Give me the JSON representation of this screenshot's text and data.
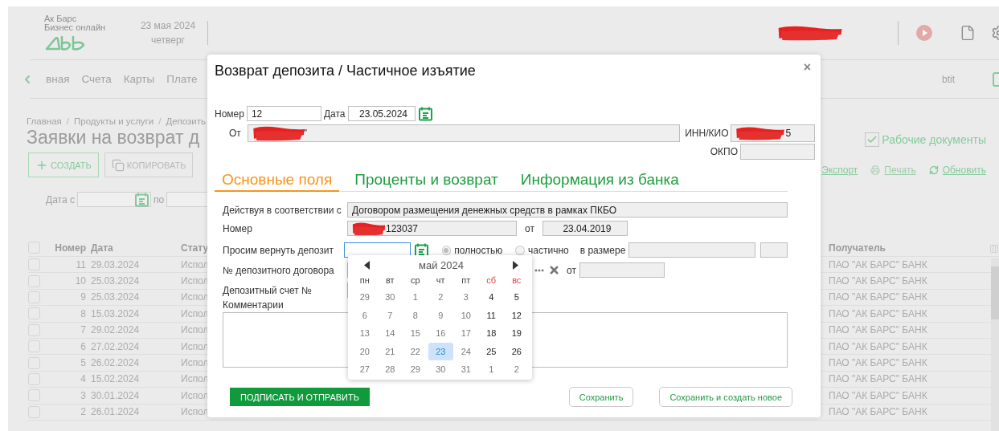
{
  "header": {
    "brand": "Ак Барс",
    "subtitle": "Бизнес онлайн",
    "date": "23 мая 2024",
    "weekday": "четверг"
  },
  "nav": {
    "items": [
      "вная",
      "Счета",
      "Карты",
      "Плате"
    ],
    "user": "btit"
  },
  "breadcrumb": [
    {
      "kind": "link",
      "text": "Главная"
    },
    {
      "kind": "separator",
      "text": "/"
    },
    {
      "kind": "link",
      "text": "Продукты и услуги"
    },
    {
      "kind": "separator",
      "text": "/"
    },
    {
      "kind": "link",
      "text": "Депозить"
    }
  ],
  "page_title": "Заявки на возврат д",
  "toolbar": {
    "buttons": [
      {
        "label": "СОЗДАТЬ",
        "kind": "create",
        "disabled": false
      },
      {
        "label": "КОПИРОВАТЬ",
        "kind": "copy",
        "disabled": true
      }
    ],
    "working_docs": {
      "label": "Рабочие документы",
      "checked": true
    },
    "actions": [
      {
        "label": "Экспорт",
        "kind": "export",
        "disabled": false
      },
      {
        "label": "Печать",
        "kind": "print",
        "disabled": true
      },
      {
        "label": "Обновить",
        "kind": "refresh",
        "disabled": false
      }
    ]
  },
  "filter": {
    "from_label": "Дата с",
    "to_label": "по"
  },
  "table": {
    "select_all_checked": false,
    "columns": [
      "Номер",
      "Дата",
      "Стату",
      "Получатель"
    ],
    "rows": [
      {
        "checked": false,
        "number": "11",
        "date": "29.03.2024",
        "status": "Испол",
        "recipient": "ПАО \"АК БАРС\" БАНК"
      },
      {
        "checked": false,
        "number": "10",
        "date": "25.03.2024",
        "status": "Испол",
        "recipient": "ПАО \"АК БАРС\" БАНК"
      },
      {
        "checked": false,
        "number": "9",
        "date": "25.03.2024",
        "status": "Испол",
        "recipient": "ПАО \"АК БАРС\" БАНК"
      },
      {
        "checked": false,
        "number": "8",
        "date": "15.03.2024",
        "status": "Испол",
        "recipient": "ПАО \"АК БАРС\" БАНК"
      },
      {
        "checked": false,
        "number": "7",
        "date": "29.02.2024",
        "status": "Испол",
        "recipient": "ПАО \"АК БАРС\" БАНК"
      },
      {
        "checked": false,
        "number": "6",
        "date": "27.02.2024",
        "status": "Испол",
        "recipient": "ПАО \"АК БАРС\" БАНК"
      },
      {
        "checked": false,
        "number": "5",
        "date": "26.02.2024",
        "status": "Испол",
        "recipient": "ПАО \"АК БАРС\" БАНК"
      },
      {
        "checked": false,
        "number": "4",
        "date": "15.02.2024",
        "status": "Испол",
        "recipient": "ПАО \"АК БАРС\" БАНК"
      },
      {
        "checked": false,
        "number": "3",
        "date": "30.01.2024",
        "status": "Испол",
        "recipient": "ПАО \"АК БАРС\" БАНК"
      },
      {
        "checked": false,
        "number": "2",
        "date": "26.01.2024",
        "status": "Испол",
        "recipient": "ПАО \"АК БАРС\" БАНК"
      }
    ]
  },
  "modal": {
    "title": "Возврат депозита / Частичное изъятие",
    "close": "×",
    "number_label": "Номер",
    "number": "12",
    "date_label": "Дата",
    "date": "23.05.2024",
    "from_label": "От",
    "from_value": "\"",
    "inn_label": "ИНН/КИО",
    "inn_value": "5",
    "okpo_label": "ОКПО",
    "tabs": [
      {
        "label": "Основные поля",
        "selected": true
      },
      {
        "label": "Проценты и возврат",
        "selected": false
      },
      {
        "label": "Информация из банка",
        "selected": false
      }
    ],
    "basis_label": "Действуя в соответствии с",
    "basis_value": "Договором размещения денежных средств в рамках ПКБО",
    "contract_label": "Номер",
    "contract_value": "123037",
    "contract_date_label": "от",
    "contract_date": "23.04.2019",
    "return_label": "Просим вернуть депозит",
    "radios": [
      {
        "label": "полностью",
        "selected": true
      },
      {
        "label": "частично",
        "selected": false
      }
    ],
    "amount_label": "в размере",
    "deposit_contract_label": "№ депозитного договора",
    "deposit_date_label": "от",
    "account_label": "Депозитный счет №",
    "comments_label": "Комментарии",
    "buttons": [
      {
        "label": "ПОДПИСАТЬ И ОТПРАВИТЬ",
        "primary": true
      },
      {
        "label": "Сохранить",
        "primary": false
      },
      {
        "label": "Сохранить и создать новое",
        "primary": false
      }
    ]
  },
  "calendar": {
    "month": "май 2024",
    "weekdays": [
      {
        "label": "пн",
        "weekend": false
      },
      {
        "label": "вт",
        "weekend": false
      },
      {
        "label": "ср",
        "weekend": false
      },
      {
        "label": "чт",
        "weekend": false
      },
      {
        "label": "пт",
        "weekend": false
      },
      {
        "label": "сб",
        "weekend": true
      },
      {
        "label": "вс",
        "weekend": true
      }
    ],
    "weeks": [
      [
        {
          "day": "29",
          "muted": true,
          "selected": false
        },
        {
          "day": "30",
          "muted": true,
          "selected": false
        },
        {
          "day": "1",
          "muted": true,
          "selected": false
        },
        {
          "day": "2",
          "muted": true,
          "selected": false
        },
        {
          "day": "3",
          "muted": true,
          "selected": false
        },
        {
          "day": "4",
          "muted": false,
          "selected": false
        },
        {
          "day": "5",
          "muted": false,
          "selected": false
        }
      ],
      [
        {
          "day": "6",
          "muted": true,
          "selected": false
        },
        {
          "day": "7",
          "muted": true,
          "selected": false
        },
        {
          "day": "8",
          "muted": true,
          "selected": false
        },
        {
          "day": "9",
          "muted": true,
          "selected": false
        },
        {
          "day": "10",
          "muted": true,
          "selected": false
        },
        {
          "day": "11",
          "muted": false,
          "selected": false
        },
        {
          "day": "12",
          "muted": false,
          "selected": false
        }
      ],
      [
        {
          "day": "13",
          "muted": true,
          "selected": false
        },
        {
          "day": "14",
          "muted": true,
          "selected": false
        },
        {
          "day": "15",
          "muted": true,
          "selected": false
        },
        {
          "day": "16",
          "muted": true,
          "selected": false
        },
        {
          "day": "17",
          "muted": true,
          "selected": false
        },
        {
          "day": "18",
          "muted": false,
          "selected": false
        },
        {
          "day": "19",
          "muted": false,
          "selected": false
        }
      ],
      [
        {
          "day": "20",
          "muted": true,
          "selected": false
        },
        {
          "day": "21",
          "muted": true,
          "selected": false
        },
        {
          "day": "22",
          "muted": true,
          "selected": false
        },
        {
          "day": "23",
          "muted": true,
          "selected": true
        },
        {
          "day": "24",
          "muted": true,
          "selected": false
        },
        {
          "day": "25",
          "muted": false,
          "selected": false
        },
        {
          "day": "26",
          "muted": false,
          "selected": false
        }
      ],
      [
        {
          "day": "27",
          "muted": true,
          "selected": false
        },
        {
          "day": "28",
          "muted": true,
          "selected": false
        },
        {
          "day": "29",
          "muted": true,
          "selected": false
        },
        {
          "day": "30",
          "muted": true,
          "selected": false
        },
        {
          "day": "31",
          "muted": true,
          "selected": false
        },
        {
          "day": "1",
          "muted": true,
          "selected": false
        },
        {
          "day": "2",
          "muted": true,
          "selected": false
        }
      ]
    ]
  }
}
